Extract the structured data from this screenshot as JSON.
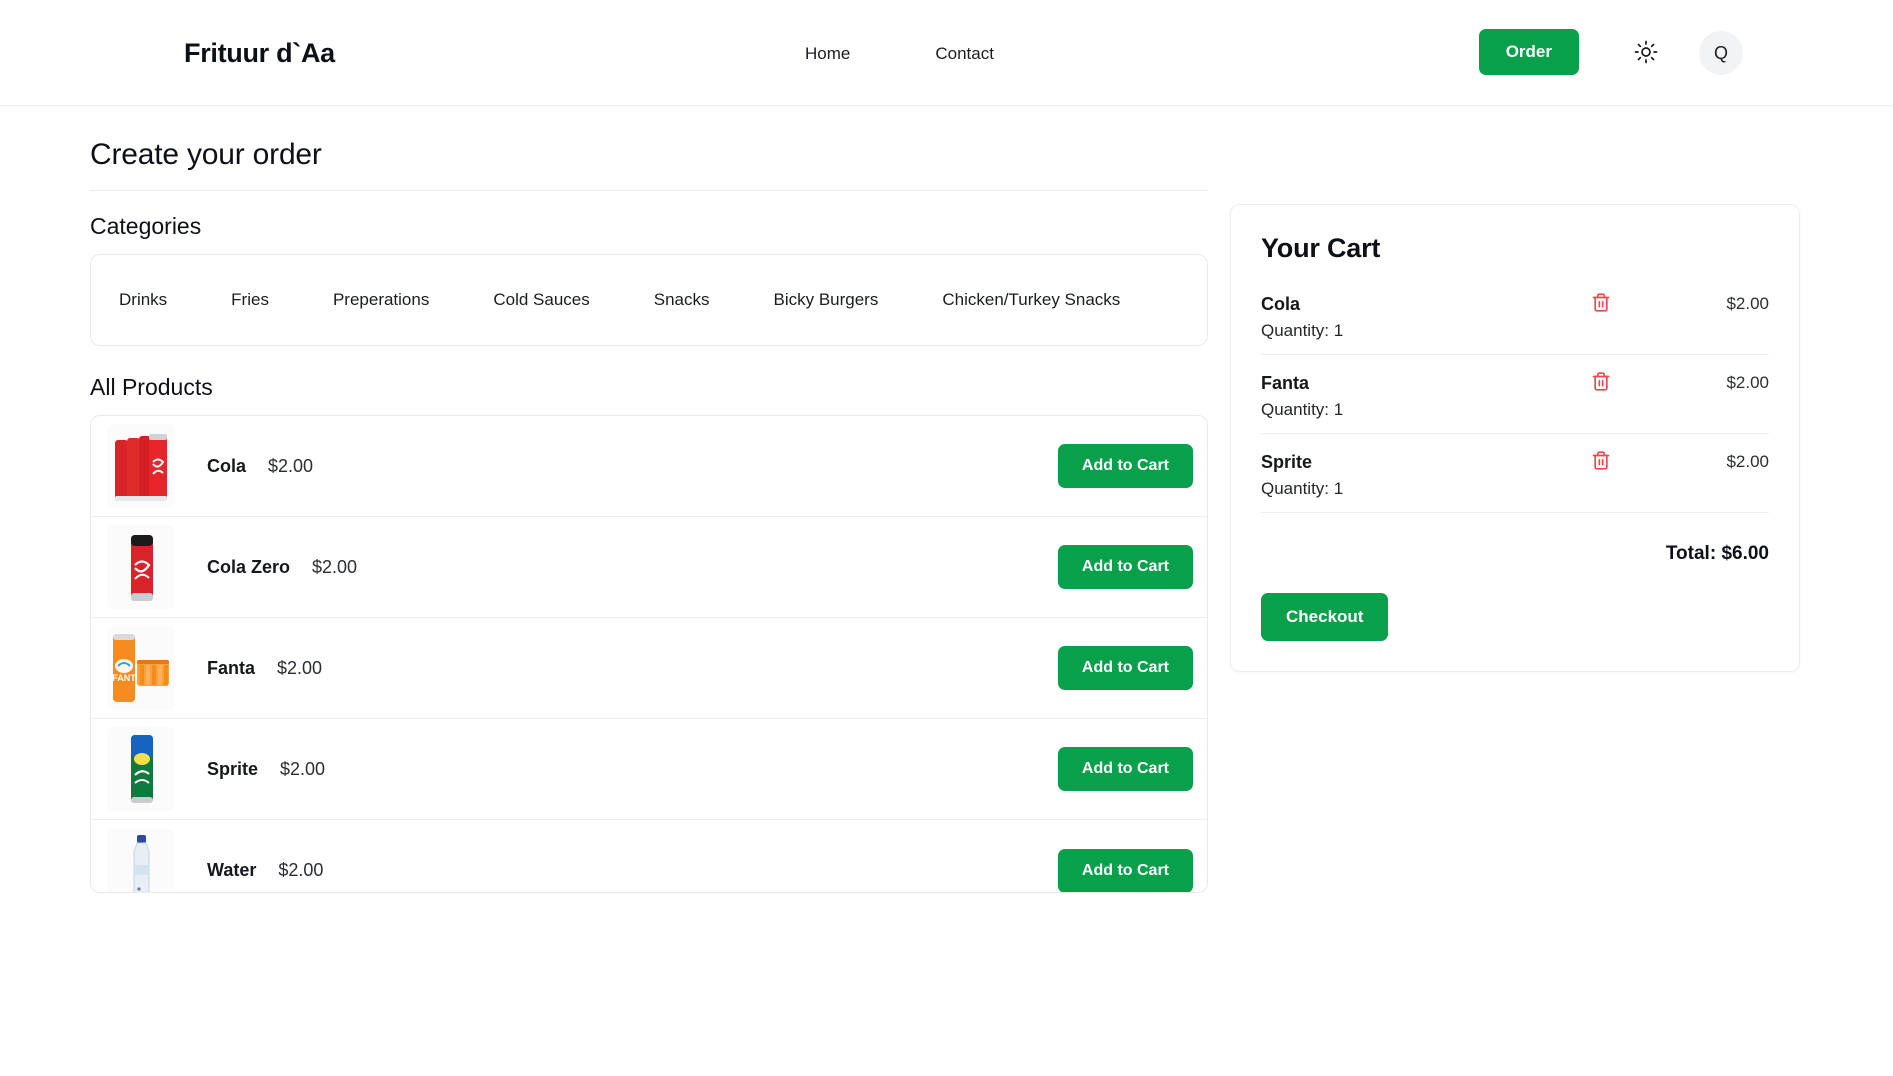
{
  "header": {
    "brand": "Frituur d`Aa",
    "nav": [
      {
        "label": "Home",
        "name": "nav-home"
      },
      {
        "label": "Contact",
        "name": "nav-contact"
      }
    ],
    "order_label": "Order",
    "theme_icon": "sun-icon",
    "search_icon": "search-q-icon",
    "search_glyph": "Q",
    "accent_color": "#08a04b"
  },
  "main": {
    "page_title": "Create your order",
    "categories_heading": "Categories",
    "categories": [
      "Drinks",
      "Fries",
      "Preperations",
      "Cold Sauces",
      "Snacks",
      "Bicky Burgers",
      "Chicken/Turkey Snacks"
    ],
    "products_heading": "All Products",
    "add_to_cart_label": "Add to Cart",
    "products": [
      {
        "name": "Cola",
        "price": "$2.00",
        "image": "coca-cola-cans-pack-image"
      },
      {
        "name": "Cola Zero",
        "price": "$2.00",
        "image": "coca-cola-zero-can-image"
      },
      {
        "name": "Fanta",
        "price": "$2.00",
        "image": "fanta-orange-can-pack-image"
      },
      {
        "name": "Sprite",
        "price": "$2.00",
        "image": "sprite-can-image"
      },
      {
        "name": "Water",
        "price": "$2.00",
        "image": "water-bottle-image"
      }
    ]
  },
  "cart": {
    "title": "Your Cart",
    "quantity_prefix": "Quantity: ",
    "items": [
      {
        "name": "Cola",
        "quantity_label": "Quantity: 1",
        "price": "$2.00",
        "remove_icon": "trash-icon"
      },
      {
        "name": "Fanta",
        "quantity_label": "Quantity: 1",
        "price": "$2.00",
        "remove_icon": "trash-icon"
      },
      {
        "name": "Sprite",
        "quantity_label": "Quantity: 1",
        "price": "$2.00",
        "remove_icon": "trash-icon"
      }
    ],
    "total_label": "Total: $6.00",
    "checkout_label": "Checkout",
    "remove_color": "#f2474a"
  }
}
